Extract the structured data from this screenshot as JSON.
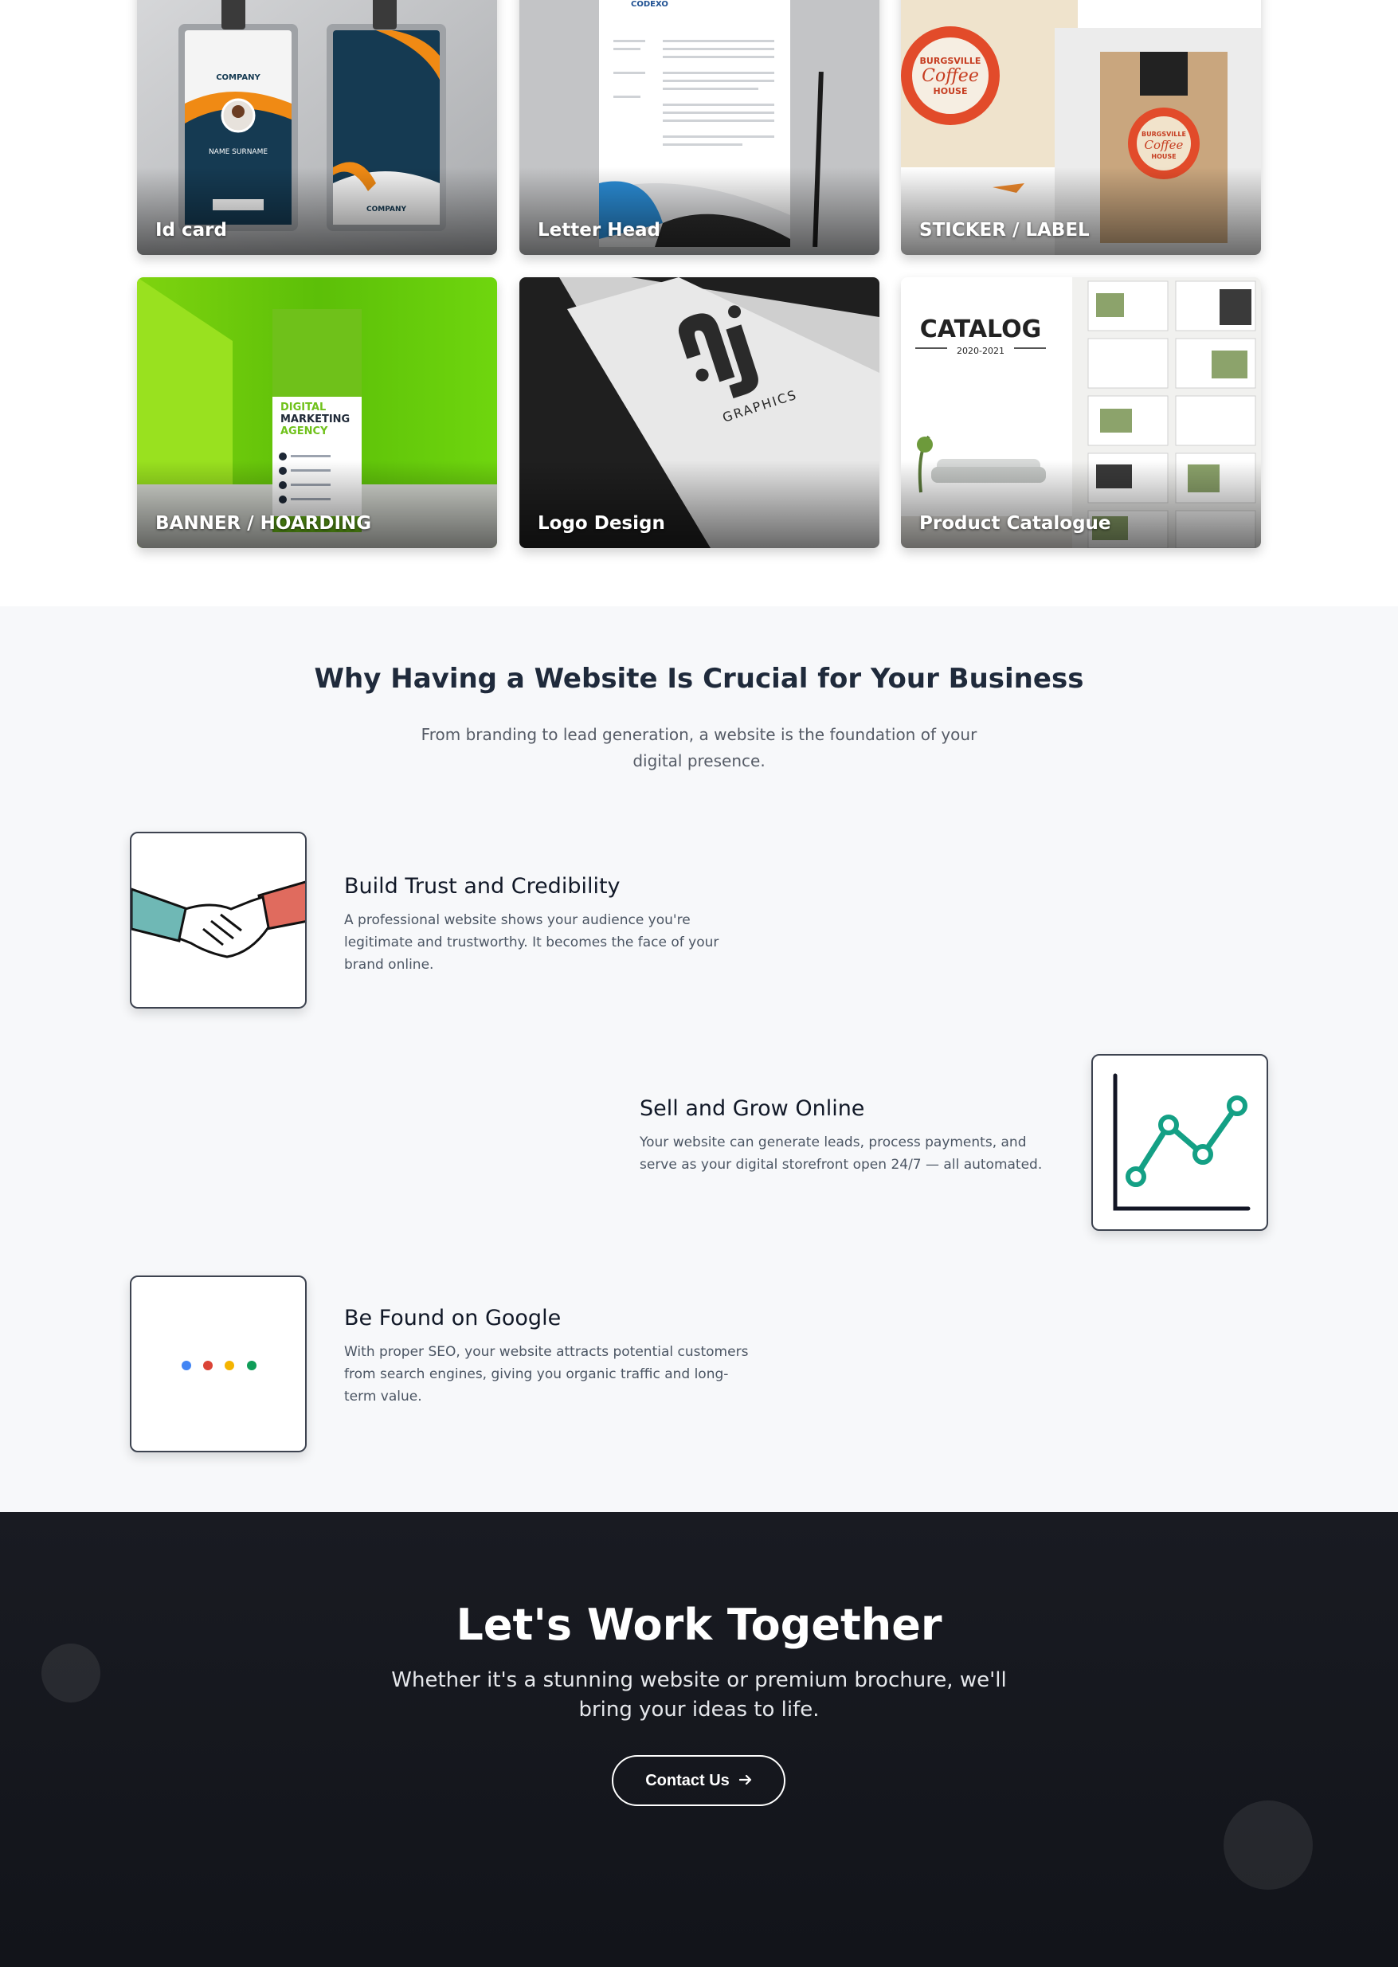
{
  "portfolio": {
    "tiles": [
      {
        "label": "Id card"
      },
      {
        "label": "Letter Head"
      },
      {
        "label": "STICKER / LABEL"
      },
      {
        "label": "BANNER / HOARDING"
      },
      {
        "label": "Logo Design"
      },
      {
        "label": "Product Catalogue"
      }
    ],
    "idcard_company": "COMPANY",
    "idcard_name": "NAME SURNAME",
    "letterhead_brand": "CODEXO",
    "sticker_text": [
      "BURGSVILLE",
      "Coffee",
      "HOUSE"
    ],
    "banner_text": [
      "DIGITAL",
      "MARKETING",
      "AGENCY"
    ],
    "logo_text": "GRAPHICS",
    "catalog_title": "CATALOG",
    "catalog_year": "2020-2021"
  },
  "why": {
    "title": "Why Having a Website Is Crucial for Your Business",
    "subtitle": "From branding to lead generation, a website is the foundation of your digital presence.",
    "features": [
      {
        "icon": "handshake-icon",
        "title": "Build Trust and Credibility",
        "text": "A professional website shows your audience you're legitimate and trustworthy. It becomes the face of your brand online."
      },
      {
        "icon": "growth-chart-icon",
        "title": "Sell and Grow Online",
        "text": "Your website can generate leads, process payments, and serve as your digital storefront open 24/7 — all automated."
      },
      {
        "icon": "google-dots-icon",
        "title": "Be Found on Google",
        "text": "With proper SEO, your website attracts potential customers from search engines, giving you organic traffic and long-term value."
      }
    ],
    "colors": {
      "chart": "#14a085",
      "google": [
        "#4285f4",
        "#db4437",
        "#f4b400",
        "#0f9d58"
      ]
    }
  },
  "cta": {
    "title": "Let's Work Together",
    "text": "Whether it's a stunning website or premium brochure, we'll bring your ideas to life.",
    "button": "Contact Us",
    "button_icon": "arrow-right-icon"
  }
}
